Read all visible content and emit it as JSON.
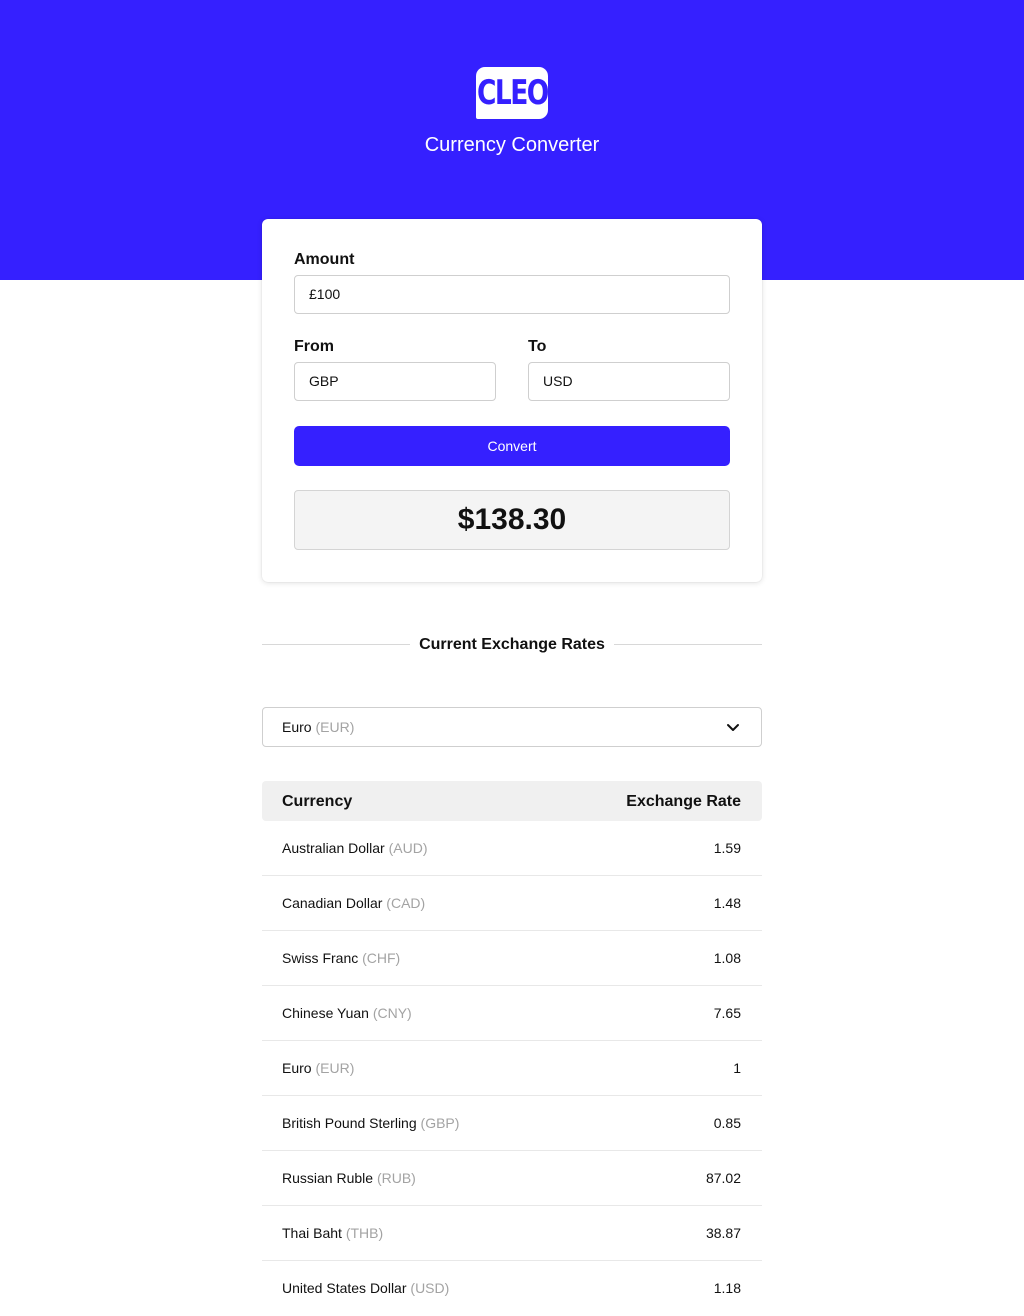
{
  "header": {
    "logo_text": "CLEO",
    "title": "Currency Converter",
    "brand_color": "#3520ff"
  },
  "converter": {
    "amount_label": "Amount",
    "amount_value": "£100",
    "from_label": "From",
    "from_value": "GBP",
    "to_label": "To",
    "to_value": "USD",
    "convert_label": "Convert",
    "result": "$138.30"
  },
  "rates": {
    "section_title": "Current Exchange Rates",
    "base_select": {
      "name": "Euro",
      "code": "(EUR)"
    },
    "columns": {
      "currency": "Currency",
      "rate": "Exchange Rate"
    },
    "rows": [
      {
        "name": "Australian Dollar",
        "code": "(AUD)",
        "rate": "1.59"
      },
      {
        "name": "Canadian Dollar",
        "code": "(CAD)",
        "rate": "1.48"
      },
      {
        "name": "Swiss Franc",
        "code": "(CHF)",
        "rate": "1.08"
      },
      {
        "name": "Chinese Yuan",
        "code": "(CNY)",
        "rate": "7.65"
      },
      {
        "name": "Euro",
        "code": "(EUR)",
        "rate": "1"
      },
      {
        "name": "British Pound Sterling",
        "code": "(GBP)",
        "rate": "0.85"
      },
      {
        "name": "Russian Ruble",
        "code": "(RUB)",
        "rate": "87.02"
      },
      {
        "name": "Thai Baht",
        "code": "(THB)",
        "rate": "38.87"
      },
      {
        "name": "United States Dollar",
        "code": "(USD)",
        "rate": "1.18"
      }
    ]
  }
}
